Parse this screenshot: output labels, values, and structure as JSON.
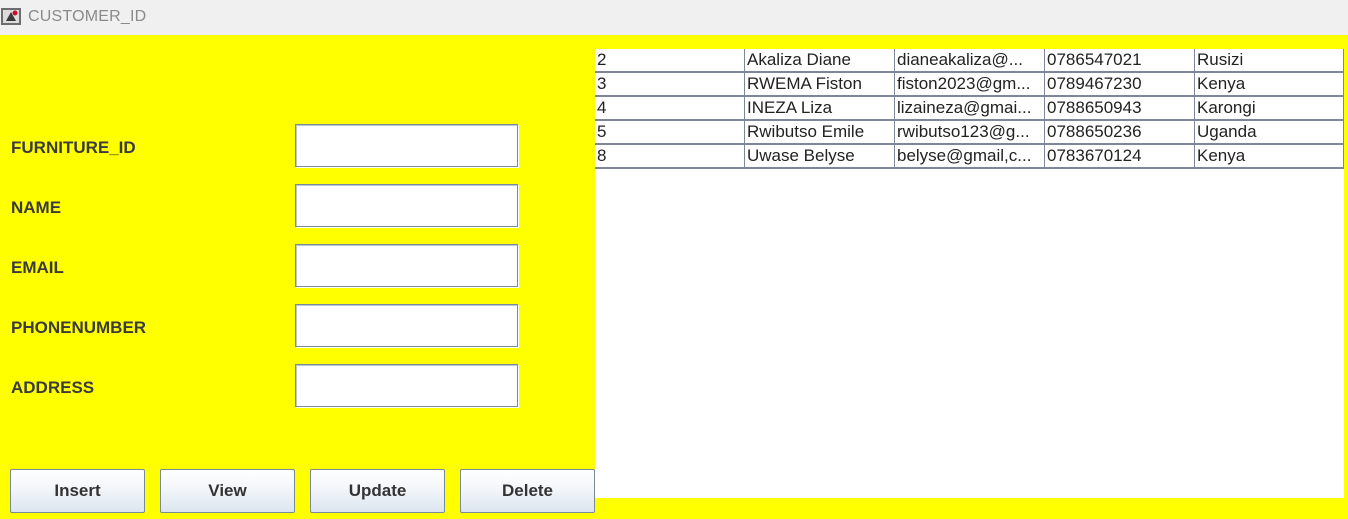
{
  "window": {
    "title": "CUSTOMER_ID"
  },
  "form": {
    "fields": [
      {
        "label": "FURNITURE_ID",
        "value": ""
      },
      {
        "label": "NAME",
        "value": ""
      },
      {
        "label": "EMAIL",
        "value": ""
      },
      {
        "label": "PHONENUMBER",
        "value": ""
      },
      {
        "label": "ADDRESS",
        "value": ""
      }
    ]
  },
  "buttons": {
    "insert": "Insert",
    "view": "View",
    "update": "Update",
    "delete": "Delete"
  },
  "table": {
    "rows": [
      [
        "2",
        "Akaliza Diane",
        "dianeakaliza@...",
        "0786547021",
        "Rusizi"
      ],
      [
        "3",
        "RWEMA Fiston",
        "fiston2023@gm...",
        "0789467230",
        "Kenya"
      ],
      [
        "4",
        "INEZA Liza",
        "lizaineza@gmai...",
        "0788650943",
        "Karongi"
      ],
      [
        "5",
        "Rwibutso Emile",
        "rwibutso123@g...",
        "0788650236",
        "Uganda"
      ],
      [
        "8",
        "Uwase Belyse",
        "belyse@gmail,c...",
        "0783670124",
        "Kenya"
      ]
    ]
  },
  "colors": {
    "background": "#ffff00",
    "table_border": "#7d8795"
  }
}
